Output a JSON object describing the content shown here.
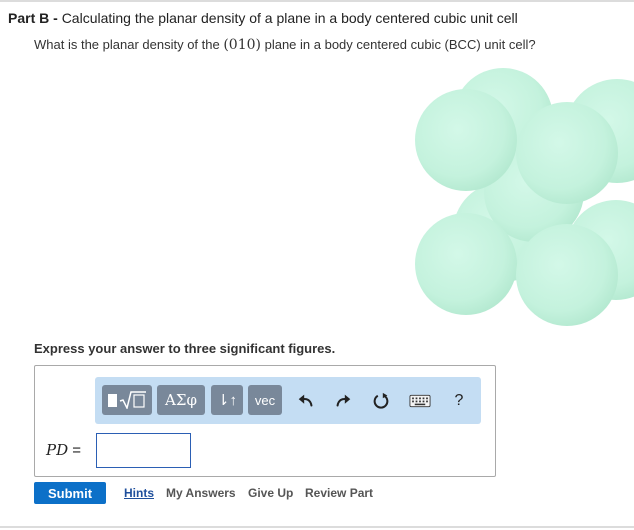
{
  "part": {
    "label": "Part B -",
    "title": "Calculating the planar density of a plane in a body centered cubic unit cell"
  },
  "question": {
    "before": "What is the planar density of the ",
    "plane": "(010)",
    "after": " plane in a body centered cubic (BCC) unit cell?"
  },
  "instruction": "Express your answer to three significant figures.",
  "answer": {
    "variable": "PD",
    "equals": " =",
    "value": ""
  },
  "toolbar": {
    "greek_label": "ΑΣφ",
    "arrows_label": "⇂↑",
    "vec_label": "vec",
    "help_label": "?"
  },
  "actions": {
    "submit": "Submit",
    "hints": "Hints",
    "my_answers": "My Answers",
    "give_up": "Give Up",
    "review_part": "Review Part"
  },
  "colors": {
    "submit_bg": "#0c70c8",
    "toolbar_bg": "#c4ddf3",
    "toolbar_button": "#79889a",
    "atom": "#c6f3e0"
  }
}
